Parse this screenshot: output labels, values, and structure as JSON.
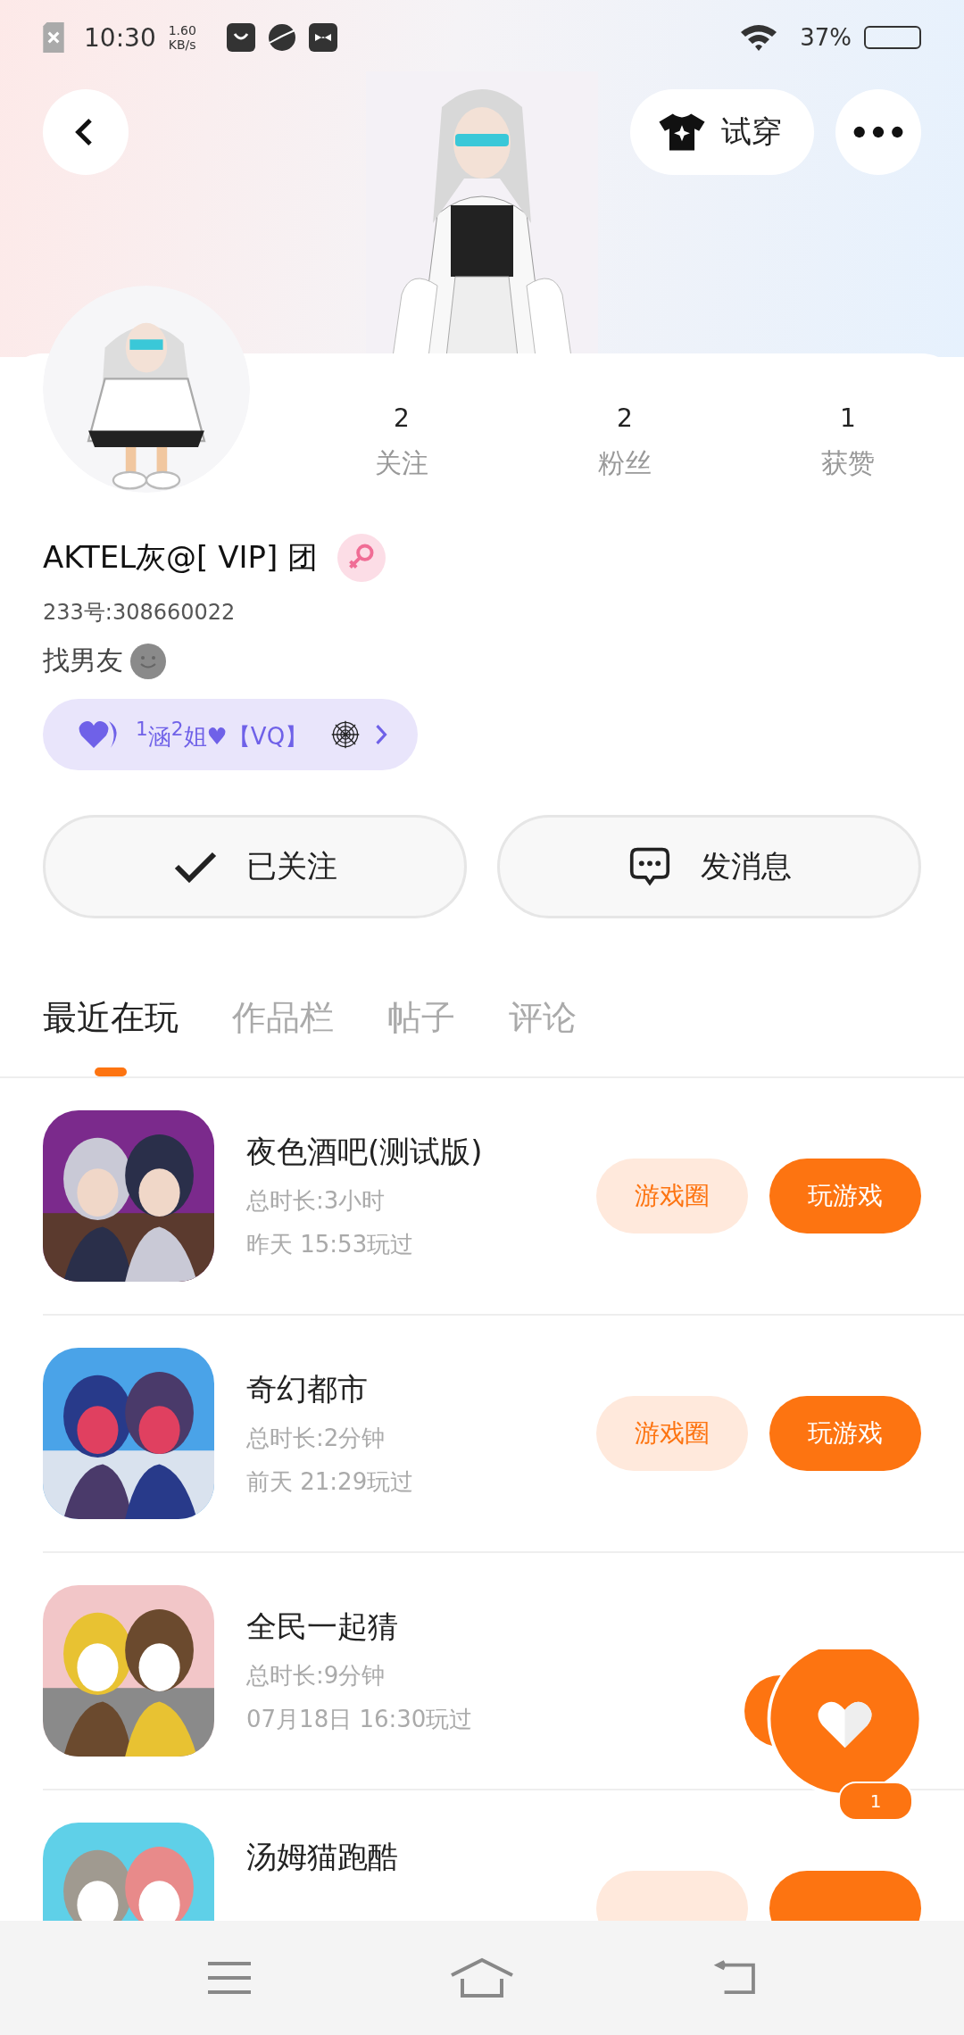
{
  "status_bar": {
    "time": "10:30",
    "net_speed": "1.60",
    "net_unit": "KB/s",
    "battery": "37%"
  },
  "top_bar": {
    "try_on": "试穿"
  },
  "stats": [
    {
      "value": "2",
      "label": "关注"
    },
    {
      "value": "2",
      "label": "粉丝"
    },
    {
      "value": "1",
      "label": "获赞"
    }
  ],
  "profile": {
    "name": "AKTEL灰@[ VIP] 团",
    "id": "233号:308660022",
    "bio": "找男友",
    "tag": "$^{1}$涵$^{2}$姐♥【VQ】"
  },
  "actions": [
    {
      "label": "已关注",
      "kind": "followed"
    },
    {
      "label": "发消息",
      "kind": "message"
    }
  ],
  "tabs": [
    {
      "label": "最近在玩",
      "selected": true
    },
    {
      "label": "作品栏",
      "selected": false
    },
    {
      "label": "帖子",
      "selected": false
    },
    {
      "label": "评论",
      "selected": false
    }
  ],
  "games": [
    {
      "title": "夜色酒吧(测试版)",
      "duration": "总时长:3小时",
      "last_played": "昨天 15:53玩过",
      "buttons": [
        {
          "label": "游戏圈",
          "kind": "circle"
        },
        {
          "label": "玩游戏",
          "kind": "play"
        }
      ]
    },
    {
      "title": "奇幻都市",
      "duration": "总时长:2分钟",
      "last_played": "前天 21:29玩过",
      "buttons": [
        {
          "label": "游戏圈",
          "kind": "circle"
        },
        {
          "label": "玩游戏",
          "kind": "play"
        }
      ]
    },
    {
      "title": "全民一起猜",
      "duration": "总时长:9分钟",
      "last_played": "07月18日 16:30玩过"
    },
    {
      "title": "汤姆猫跑酷",
      "buttons": [
        {
          "kind": "circle"
        },
        {
          "kind": "play"
        }
      ]
    }
  ],
  "like_float": {
    "count": "1"
  }
}
